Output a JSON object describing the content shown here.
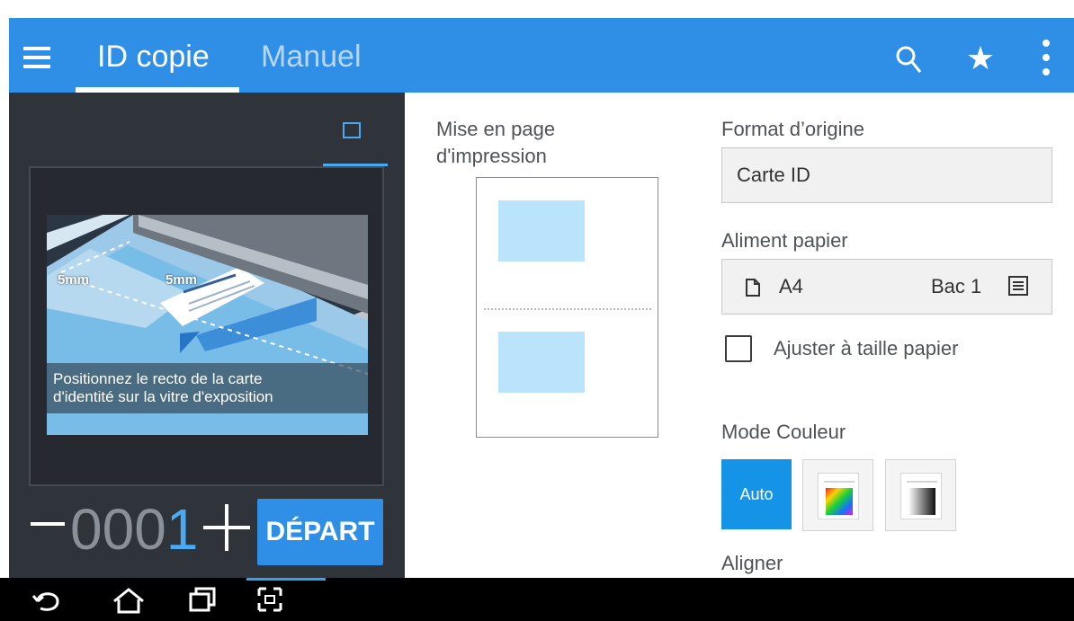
{
  "app": {
    "tabs": [
      {
        "label": "ID copie"
      },
      {
        "label": "Manuel"
      }
    ]
  },
  "preview": {
    "caption_line1": "Positionnez le recto de la carte",
    "caption_line2": "d'identité sur la vitre d'exposition",
    "measure_left": "5mm",
    "measure_right": "5mm"
  },
  "copies": {
    "prefix": "000",
    "active_digit": "1"
  },
  "actions": {
    "start": "DÉPART"
  },
  "layout": {
    "label": "Mise en page d'impression"
  },
  "settings": {
    "format_label": "Format d’origine",
    "format_value": "Carte ID",
    "paper_label": "Aliment papier",
    "paper_size": "A4",
    "paper_tray": "Bac 1",
    "adjust_label": "Ajuster à taille papier",
    "color_label": "Mode Couleur",
    "color_auto": "Auto",
    "align_label": "Aligner"
  },
  "colors": {
    "appbar": "#2f8ee6",
    "accent": "#49a9f2",
    "panel": "#2f343b"
  },
  "icons": {
    "menu": "menu-icon",
    "search": "search-icon",
    "star": "star-icon",
    "more": "more-vert-icon",
    "document": "document-icon",
    "tray": "tray-list-icon",
    "back": "back-icon",
    "home": "home-icon",
    "recent": "recent-apps-icon",
    "screenshot": "screenshot-icon"
  }
}
